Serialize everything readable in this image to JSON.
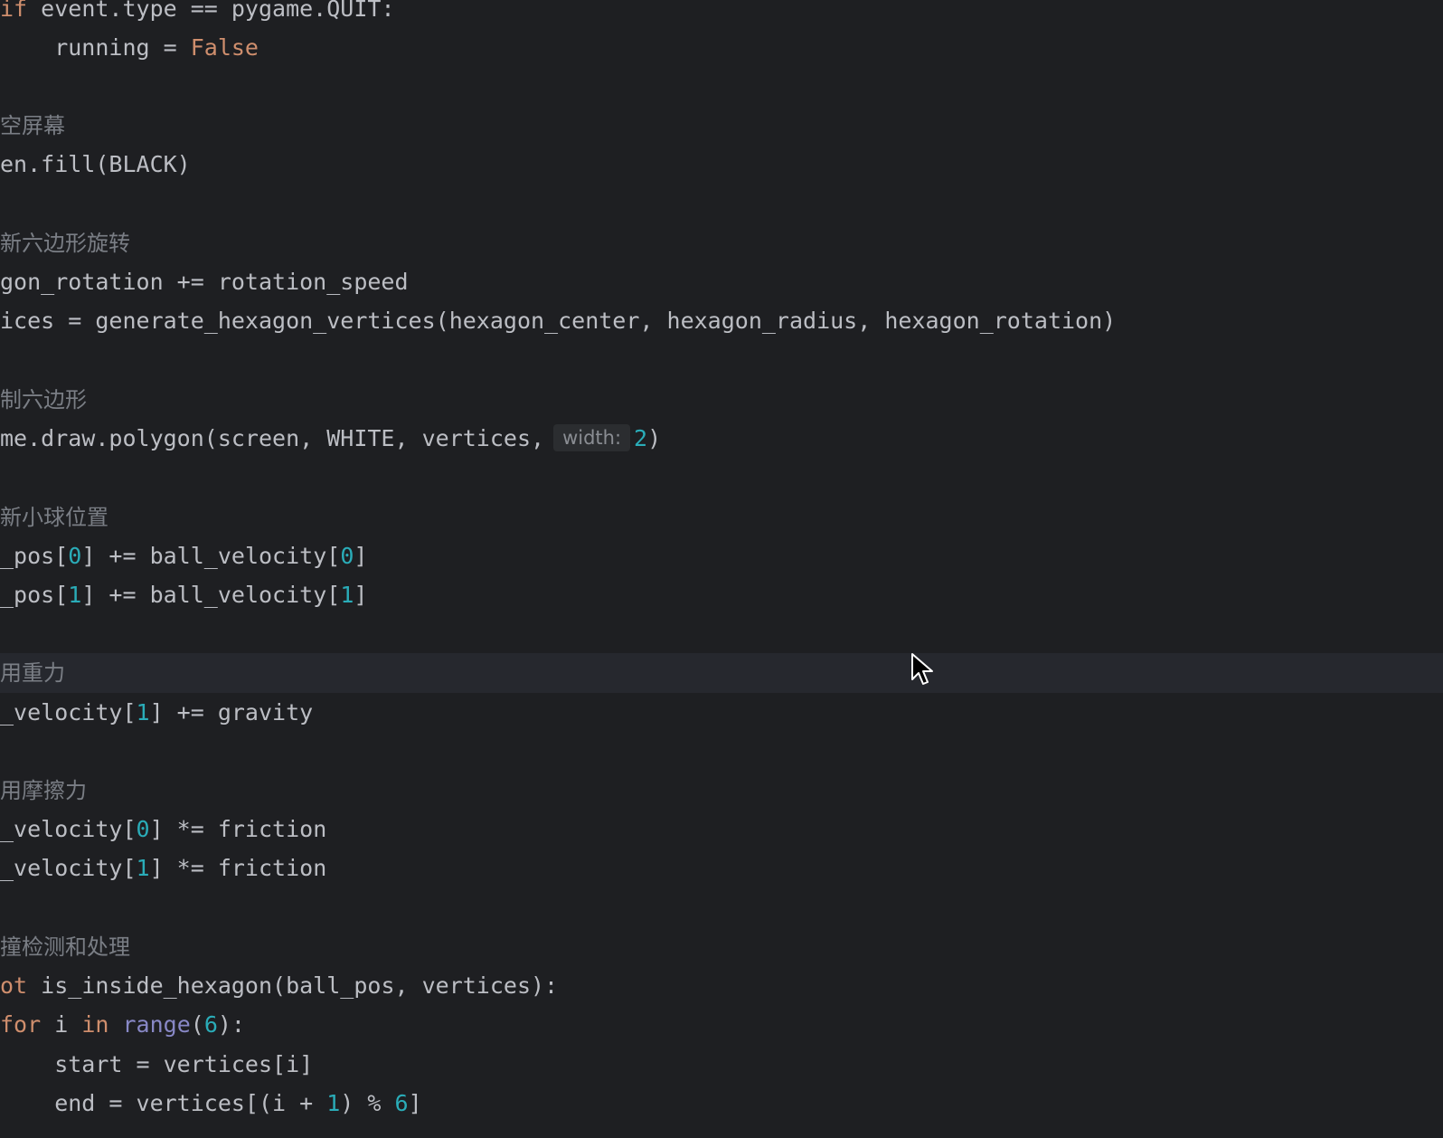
{
  "lines": {
    "l1": {
      "a": "if",
      "b": " event.type == pygame.QUIT:"
    },
    "l2": {
      "a": "    running = ",
      "b": "False"
    },
    "c1": "空屏幕",
    "l3": "en.fill(BLACK)",
    "c2": "新六边形旋转",
    "l4": "gon_rotation += rotation_speed",
    "l5": "ices = generate_hexagon_vertices(hexagon_center, hexagon_radius, hexagon_rotation)",
    "c3": "制六边形",
    "l6": {
      "a": "me.draw.polygon(screen, WHITE, vertices,",
      "hint": "width:",
      "n": "2",
      "b": ")"
    },
    "c4": "新小球位置",
    "l7": {
      "a": "_pos[",
      "n1": "0",
      "b": "] += ball_velocity[",
      "n2": "0",
      "c": "]"
    },
    "l8": {
      "a": "_pos[",
      "n1": "1",
      "b": "] += ball_velocity[",
      "n2": "1",
      "c": "]"
    },
    "c5": "用重力",
    "l9": {
      "a": "_velocity[",
      "n1": "1",
      "b": "] += gravity"
    },
    "c6": "用摩擦力",
    "l10": {
      "a": "_velocity[",
      "n1": "0",
      "b": "] *= friction"
    },
    "l11": {
      "a": "_velocity[",
      "n1": "1",
      "b": "] *= friction"
    },
    "c7": "撞检测和处理",
    "l12": {
      "kw": "ot",
      "b": " is_inside_hexagon(ball_pos, vertices):"
    },
    "l13": {
      "kw": "for",
      "b": " i ",
      "kw2": "in",
      "sp": " ",
      "fn": "range",
      "c": "(",
      "n": "6",
      "d": "):"
    },
    "l14": "    start = vertices[i]",
    "l15": {
      "a": "    end = vertices[(i + ",
      "n1": "1",
      "b": ") % ",
      "n2": "6",
      "c": "]"
    }
  },
  "icons": {
    "cursor": "mouse-pointer-icon"
  },
  "colors": {
    "background": "#1e1f22",
    "current_line": "#26282e",
    "text": "#bcbec4",
    "comment": "#7a7e85",
    "keyword": "#cf8e6d",
    "number": "#2aacb8",
    "builtin": "#8888c6"
  }
}
